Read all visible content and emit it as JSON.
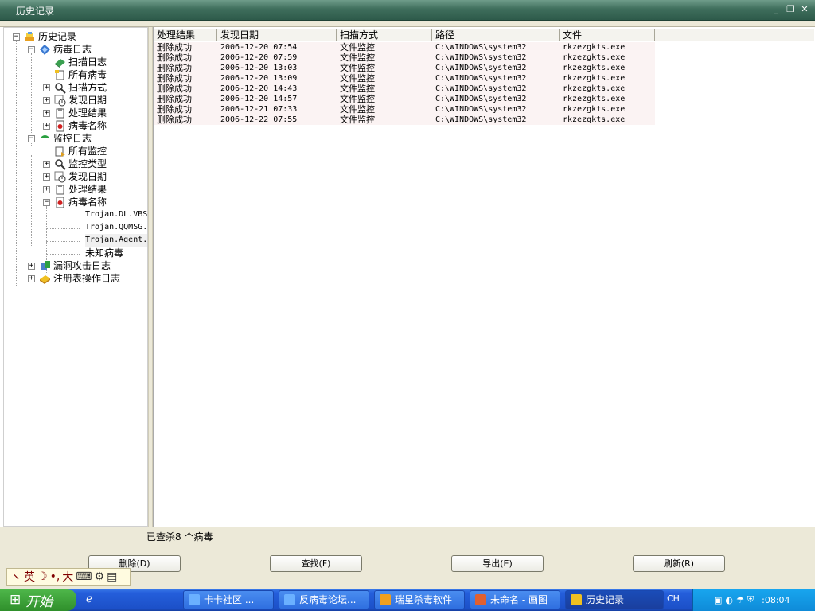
{
  "window": {
    "title": "历史记录"
  },
  "tree": {
    "nodes": [
      {
        "label": "历史记录"
      },
      {
        "label": "病毒日志"
      },
      {
        "label": "扫描日志"
      },
      {
        "label": "所有病毒"
      },
      {
        "label": "扫描方式"
      },
      {
        "label": "发现日期"
      },
      {
        "label": "处理结果"
      },
      {
        "label": "病毒名称"
      },
      {
        "label": "监控日志"
      },
      {
        "label": "所有监控"
      },
      {
        "label": "监控类型"
      },
      {
        "label": "发现日期"
      },
      {
        "label": "处理结果"
      },
      {
        "label": "病毒名称"
      },
      {
        "label": "Trojan.DL.VBS"
      },
      {
        "label": "Trojan.QQMSG."
      },
      {
        "label": "Trojan.Agent."
      },
      {
        "label": "未知病毒"
      },
      {
        "label": "漏洞攻击日志"
      },
      {
        "label": "注册表操作日志"
      }
    ]
  },
  "table": {
    "columns": [
      "处理结果",
      "发现日期",
      "扫描方式",
      "路径",
      "文件"
    ],
    "rows": [
      [
        "删除成功",
        "2006-12-20 07:54",
        "文件监控",
        "C:\\WINDOWS\\system32",
        "rkzezgkts.exe"
      ],
      [
        "删除成功",
        "2006-12-20 07:59",
        "文件监控",
        "C:\\WINDOWS\\system32",
        "rkzezgkts.exe"
      ],
      [
        "删除成功",
        "2006-12-20 13:03",
        "文件监控",
        "C:\\WINDOWS\\system32",
        "rkzezgkts.exe"
      ],
      [
        "删除成功",
        "2006-12-20 13:09",
        "文件监控",
        "C:\\WINDOWS\\system32",
        "rkzezgkts.exe"
      ],
      [
        "删除成功",
        "2006-12-20 14:43",
        "文件监控",
        "C:\\WINDOWS\\system32",
        "rkzezgkts.exe"
      ],
      [
        "删除成功",
        "2006-12-20 14:57",
        "文件监控",
        "C:\\WINDOWS\\system32",
        "rkzezgkts.exe"
      ],
      [
        "删除成功",
        "2006-12-21 07:33",
        "文件监控",
        "C:\\WINDOWS\\system32",
        "rkzezgkts.exe"
      ],
      [
        "删除成功",
        "2006-12-22 07:55",
        "文件监控",
        "C:\\WINDOWS\\system32",
        "rkzezgkts.exe"
      ]
    ]
  },
  "status": {
    "text": "已查杀8 个病毒"
  },
  "buttons": {
    "delete": "删除(D)",
    "find": "查找(F)",
    "export": "导出(E)",
    "refresh": "刷新(R)"
  },
  "ime": {
    "mode": "英",
    "size": "大"
  },
  "taskbar": {
    "start": "开始",
    "tasks": [
      "卡卡社区 ...",
      "反病毒论坛...",
      "瑞星杀毒软件",
      "未命名 - 画图",
      "历史记录"
    ],
    "lang": "CH",
    "clock": ":08:04"
  },
  "icons": {
    "history": "stack-icon",
    "virus_log": "shield-icon",
    "scan_log": "book-icon",
    "all": "document-icon",
    "scan_method": "magnifier-icon",
    "date": "clock-icon",
    "result": "clipboard-icon",
    "virus_name": "bug-document-icon",
    "monitor_log": "umbrella-icon",
    "exploit_log": "server-icon",
    "registry_log": "registry-icon"
  },
  "colors": {
    "title_bg": "#3f6e5c",
    "row_bg": "#fbf3f3",
    "taskbar": "#245edb",
    "start": "#2f8f2b"
  }
}
